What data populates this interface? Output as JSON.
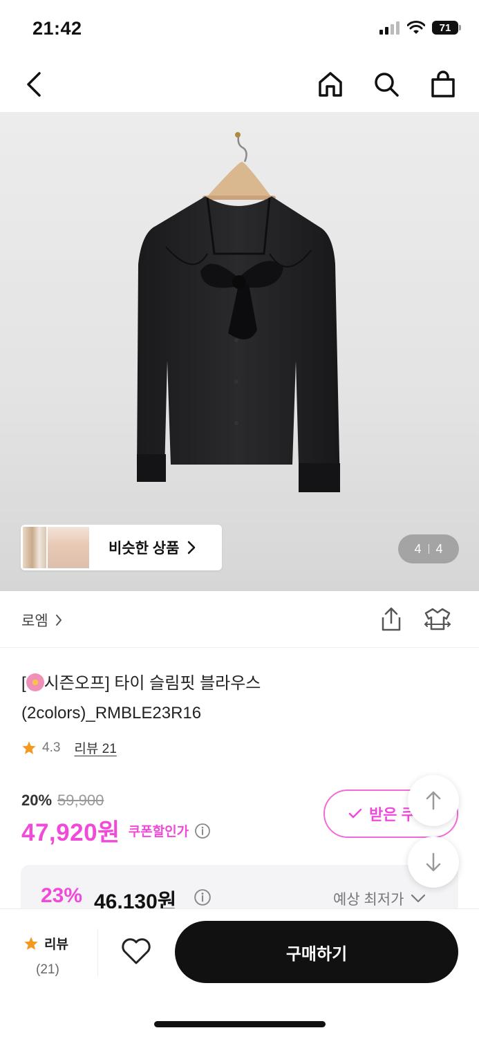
{
  "status": {
    "time": "21:42",
    "battery": "71"
  },
  "nav": {
    "back_icon": "chevron-left-icon",
    "home_icon": "home-icon",
    "search_icon": "search-icon",
    "cart_icon": "shopping-bag-icon"
  },
  "hero": {
    "similar_label": "비슷한 상품",
    "page_current": "4",
    "page_total": "4"
  },
  "brand": {
    "name": "로엠"
  },
  "product": {
    "title_prefix": "[",
    "title_rest": "시즌오프] 타이 슬림핏 블라우스",
    "title_line2": "(2colors)_RMBLE23R16",
    "rating": "4.3",
    "review_label": "리뷰 21"
  },
  "price": {
    "discount_rate": "20%",
    "original_price": "59,900",
    "sale_price": "47,920원",
    "coupon_label": "쿠폰할인가",
    "coupon_button": "받은 쿠"
  },
  "best": {
    "rate": "23%",
    "price": "46,130원",
    "label": "예상 최저가"
  },
  "bottom": {
    "review_label": "리뷰",
    "review_count": "(21)",
    "buy_label": "구매하기"
  },
  "colors": {
    "accent": "#f04ad8",
    "star": "#f39a1e",
    "buy": "#111111"
  }
}
